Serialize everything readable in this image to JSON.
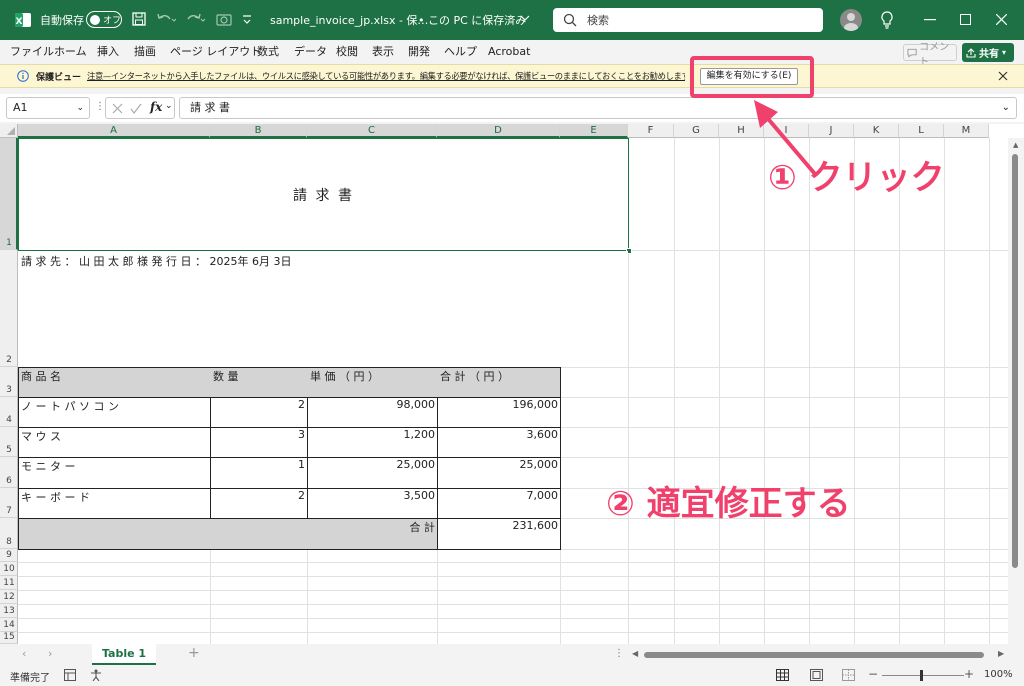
{
  "titlebar": {
    "autosave_label": "自動保存",
    "autosave_state": "オフ",
    "file_title": "sample_invoice_jp.xlsx - 保…",
    "save_location": "• この PC に保存済み",
    "search_placeholder": "検索"
  },
  "ribbon": {
    "menus": [
      "ファイル",
      "ホーム",
      "挿入",
      "描画",
      "ページ レイアウト",
      "数式",
      "データ",
      "校閲",
      "表示",
      "開発",
      "ヘルプ",
      "Acrobat"
    ],
    "comment_label": "コメント",
    "share_label": "共有"
  },
  "protected_view": {
    "label": "保護ビュー",
    "message": "注意—インターネットから入手したファイルは、ウイルスに感染している可能性があります。編集する必要がなければ、保護ビューのままにしておくことをお勧めします。",
    "enable_button": "編集を有効にする(E)"
  },
  "formula_bar": {
    "name_box": "A1",
    "fx": "fx",
    "content": "請 求 書"
  },
  "columns": [
    "A",
    "B",
    "C",
    "D",
    "E",
    "F",
    "G",
    "H",
    "I",
    "J",
    "K",
    "L",
    "M"
  ],
  "rows": [
    "1",
    "2",
    "3",
    "4",
    "5",
    "6",
    "7",
    "8",
    "9",
    "10",
    "11",
    "12",
    "13",
    "14",
    "15"
  ],
  "invoice": {
    "title": "請 求 書",
    "recipient_line": "請 求 先 ： 山 田 太 郎 様 発 行 日 ： 2025年 6月 3日",
    "headers": [
      "商 品 名",
      "数 量",
      "単 価 （ 円 ）",
      "合 計 （ 円 ）"
    ],
    "items": [
      {
        "name": "ノ ー ト パ ソ コ ン",
        "qty": "2",
        "price": "98,000",
        "total": "196,000"
      },
      {
        "name": "マ ウ ス",
        "qty": "3",
        "price": "1,200",
        "total": "3,600"
      },
      {
        "name": "モ ニ タ ー",
        "qty": "1",
        "price": "25,000",
        "total": "25,000"
      },
      {
        "name": "キ ー ボ ー ド",
        "qty": "2",
        "price": "3,500",
        "total": "7,000"
      }
    ],
    "sum_label": "合 計",
    "sum_value": "231,600"
  },
  "sheet_tabs": {
    "active": "Table 1"
  },
  "status": {
    "ready": "準備完了",
    "zoom": "100%"
  },
  "annotations": {
    "step1": "① クリック",
    "step2": "② 適宜修正する"
  },
  "colors": {
    "excel_green": "#1e7145",
    "annotation_pink": "#f0416d"
  }
}
